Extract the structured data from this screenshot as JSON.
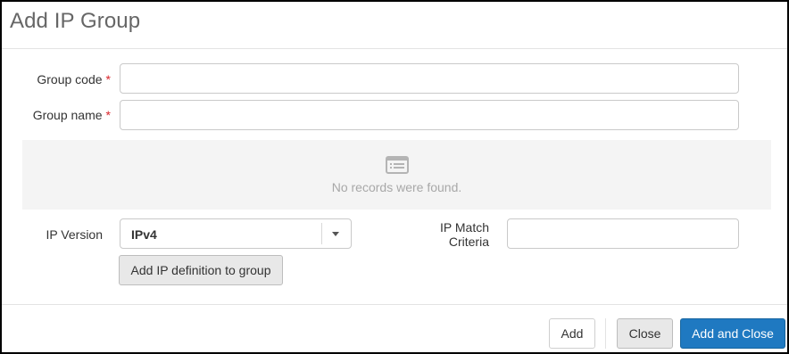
{
  "dialog": {
    "title": "Add IP Group"
  },
  "form": {
    "group_code": {
      "label": "Group code",
      "required_mark": "*",
      "value": ""
    },
    "group_name": {
      "label": "Group name",
      "required_mark": "*",
      "value": ""
    }
  },
  "records": {
    "icon": "list-icon",
    "empty_message": "No records were found."
  },
  "ip_version": {
    "label": "IP Version",
    "selected": "IPv4"
  },
  "ip_match": {
    "label_line1": "IP Match",
    "label_line2": "Criteria",
    "value": ""
  },
  "actions": {
    "add_definition_label": "Add IP definition to group",
    "add_label": "Add",
    "close_label": "Close",
    "add_and_close_label": "Add and Close"
  },
  "colors": {
    "primary": "#1f79c1",
    "required": "#d9252b"
  }
}
